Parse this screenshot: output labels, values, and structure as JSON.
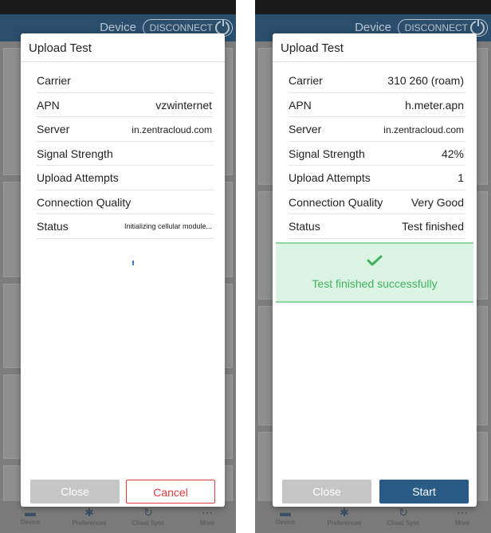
{
  "app_title": "Device",
  "disconnect_label": "DISCONNECT",
  "nav": [
    "Device",
    "Preferences",
    "Cloud Sync",
    "More"
  ],
  "left": {
    "dialog_title": "Upload Test",
    "rows": [
      {
        "label": "Carrier",
        "value": ""
      },
      {
        "label": "APN",
        "value": "vzwinternet"
      },
      {
        "label": "Server",
        "value": "in.zentracloud.com"
      },
      {
        "label": "Signal Strength",
        "value": ""
      },
      {
        "label": "Upload Attempts",
        "value": ""
      },
      {
        "label": "Connection Quality",
        "value": ""
      },
      {
        "label": "Status",
        "value": "Initializing cellular module..."
      }
    ],
    "close_label": "Close",
    "cancel_label": "Cancel"
  },
  "right": {
    "dialog_title": "Upload Test",
    "rows": [
      {
        "label": "Carrier",
        "value": "310 260 (roam)"
      },
      {
        "label": "APN",
        "value": "h.meter.apn"
      },
      {
        "label": "Server",
        "value": "in.zentracloud.com"
      },
      {
        "label": "Signal Strength",
        "value": "42%"
      },
      {
        "label": "Upload Attempts",
        "value": "1"
      },
      {
        "label": "Connection Quality",
        "value": "Very Good"
      },
      {
        "label": "Status",
        "value": "Test finished"
      }
    ],
    "success_text": "Test finished successfully",
    "close_label": "Close",
    "start_label": "Start"
  },
  "colors": {
    "appbar": "#2b4e6c",
    "cancel_red": "#e23b3b",
    "success_green": "#3fb35c",
    "start_blue": "#2a5a86"
  }
}
